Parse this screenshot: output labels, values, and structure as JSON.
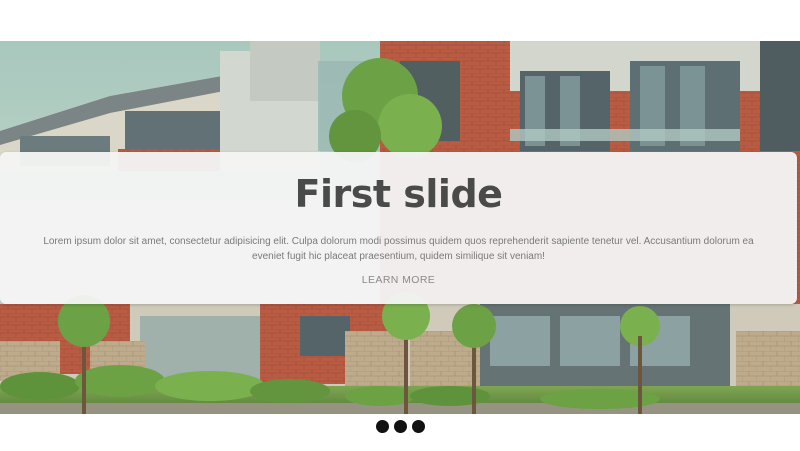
{
  "carousel": {
    "slides": [
      {
        "title": "First slide",
        "text": "Lorem ipsum dolor sit amet, consectetur adipisicing elit. Culpa dolorum modi possimus quidem quos reprehenderit sapiente tenetur vel. Accusantium dolorum ea eveniet fugit hic placeat praesentium, quidem similique sit veniam!",
        "link_label": "LEARN MORE",
        "image": "apartment-buildings-photo"
      }
    ],
    "active_index": 0,
    "indicator_count": 3
  },
  "colors": {
    "caption_background": "#f4f4f4",
    "title": "#4a4a4a",
    "text": "#7a7a7a",
    "indicator": "#111111"
  }
}
